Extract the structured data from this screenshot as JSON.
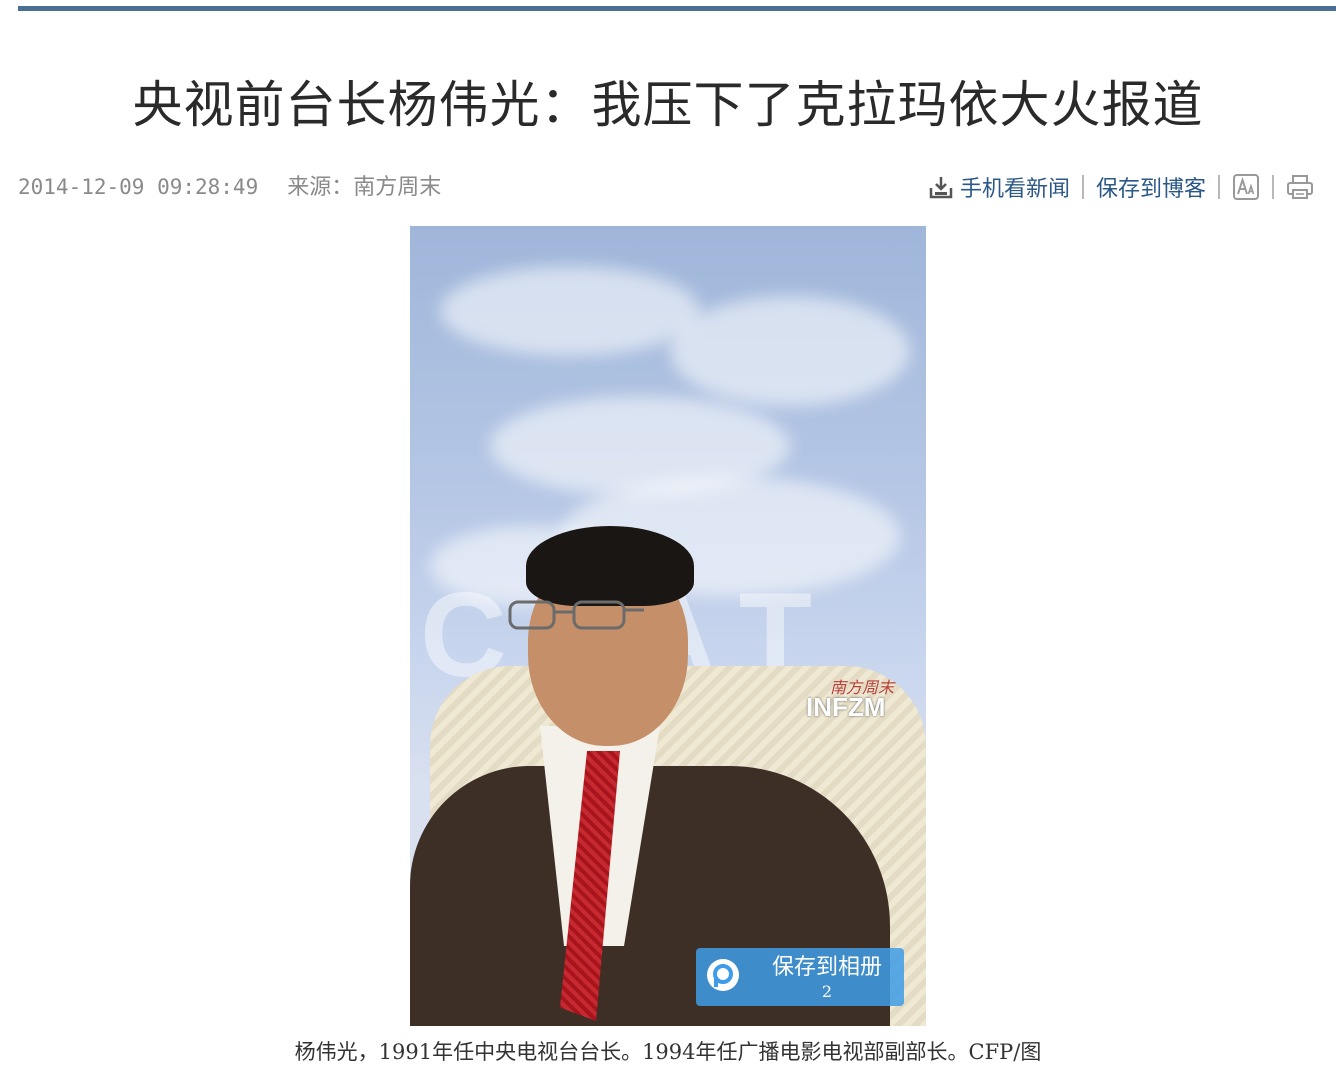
{
  "article": {
    "title": "央视前台长杨伟光：我压下了克拉玛依大火报道",
    "date": "2014-12-09 09:28:49",
    "source": "来源：南方周末",
    "tools": {
      "mobile_label": "手机看新闻",
      "blog_label": "保存到博客"
    },
    "photo": {
      "watermark_cn": "南方周末",
      "watermark": "INFZM",
      "background_text": "CTAT",
      "save_button_label": "保存到相册",
      "save_count": "2"
    },
    "caption": "杨伟光，1991年任中央电视台台长。1994年任广播电影电视部副部长。CFP/图"
  },
  "icons": [
    "download-phone-icon",
    "font-size-icon",
    "print-icon",
    "album-logo-icon"
  ],
  "colors": {
    "rule": "#4a6f94",
    "link": "#2b5887",
    "meta": "#8a8a8a",
    "album_button": "#3e9ce8"
  }
}
